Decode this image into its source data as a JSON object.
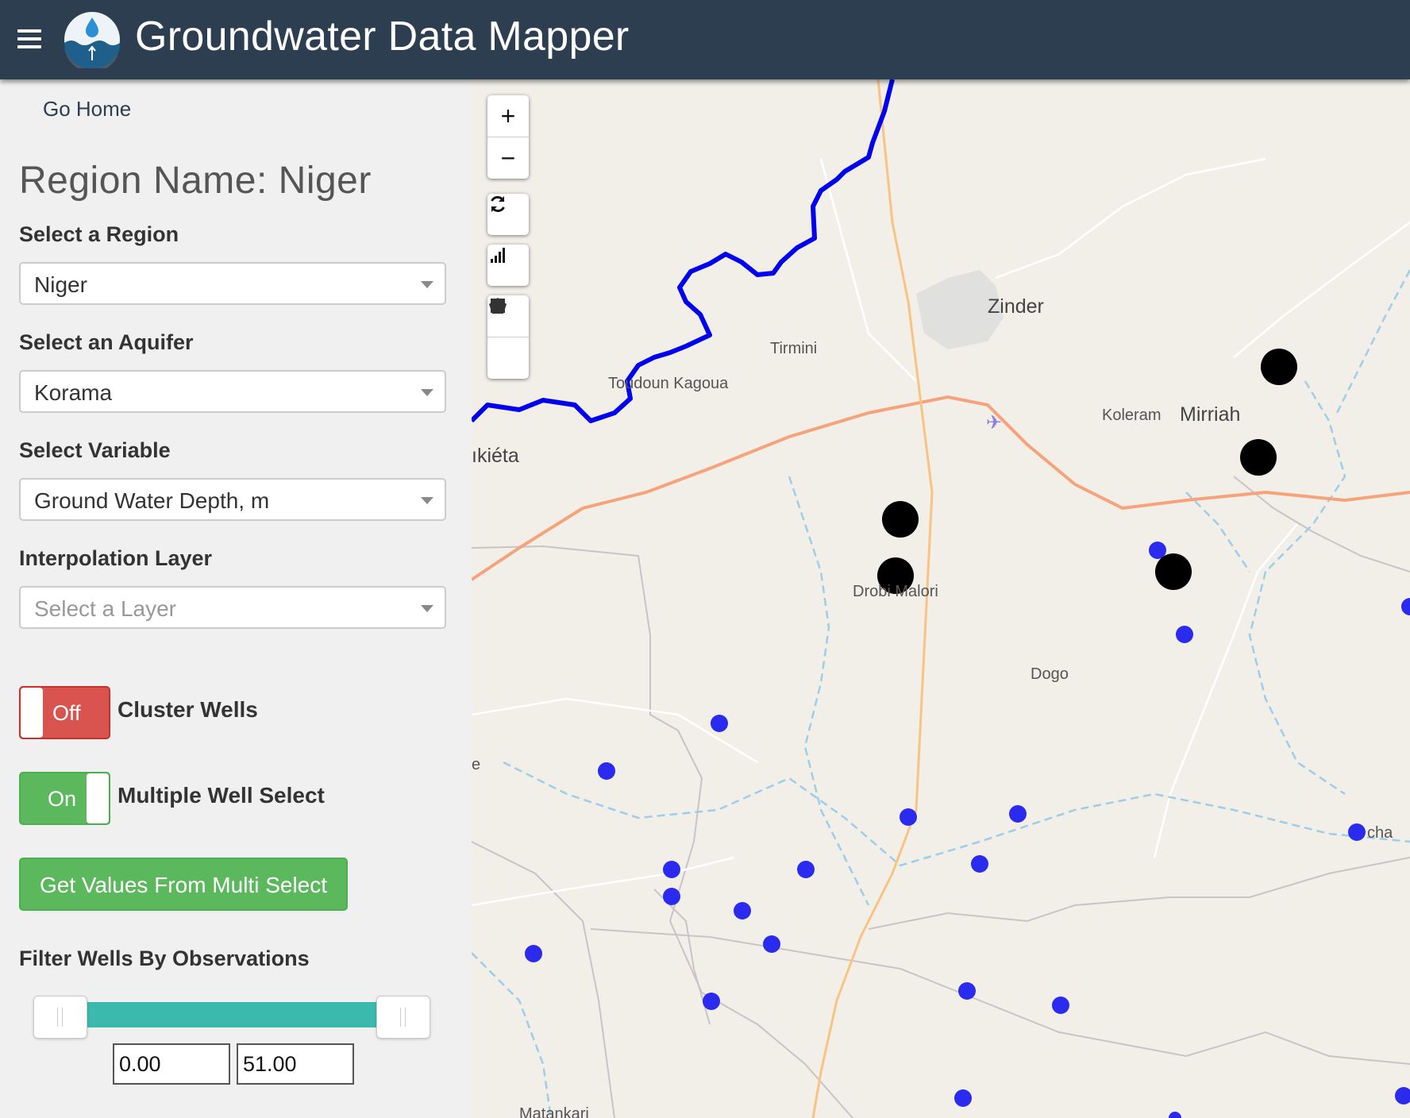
{
  "header": {
    "title": "Groundwater Data Mapper",
    "menu_icon": "hamburger-icon",
    "logo_icon": "water-drop-logo-icon",
    "bg_color": "#2c3e50"
  },
  "sidebar": {
    "go_home": "Go Home",
    "region_title": "Region Name: Niger",
    "region": {
      "label": "Select a Region",
      "value": "Niger"
    },
    "aquifer": {
      "label": "Select an Aquifer",
      "value": "Korama"
    },
    "variable": {
      "label": "Select Variable",
      "value": "Ground Water Depth, m"
    },
    "interpolation": {
      "label": "Interpolation Layer",
      "placeholder": "Select a Layer"
    },
    "cluster_toggle": {
      "state": "Off",
      "label": "Cluster Wells"
    },
    "multi_toggle": {
      "state": "On",
      "label": "Multiple Well Select"
    },
    "get_values_button": "Get Values From Multi Select",
    "filter": {
      "label": "Filter Wells By Observations",
      "min": "0.00",
      "max": "51.00"
    }
  },
  "map": {
    "controls": {
      "zoom_in": "+",
      "zoom_out": "−",
      "reset_icon": "refresh-icon",
      "chart_icon": "signal-bars-icon",
      "polygon_icon": "draw-polygon-icon",
      "rectangle_icon": "draw-rectangle-icon"
    },
    "places": {
      "zinder": "Zinder",
      "tirmini": "Tirmini",
      "toudoun_kagoua": "Toudoun Kagoua",
      "akieta": "ıkiéta",
      "koleram": "Koleram",
      "mirriah": "Mirriah",
      "drobi_malori": "Drobi Malori",
      "dogo": "Dogo",
      "e_edge": "e",
      "tacha": "cha",
      "matankari": "Matankari"
    },
    "colors": {
      "well": "#2b2bf0",
      "selected_well": "#000000",
      "boundary": "#0000ee",
      "road": "#f5a37a"
    }
  }
}
